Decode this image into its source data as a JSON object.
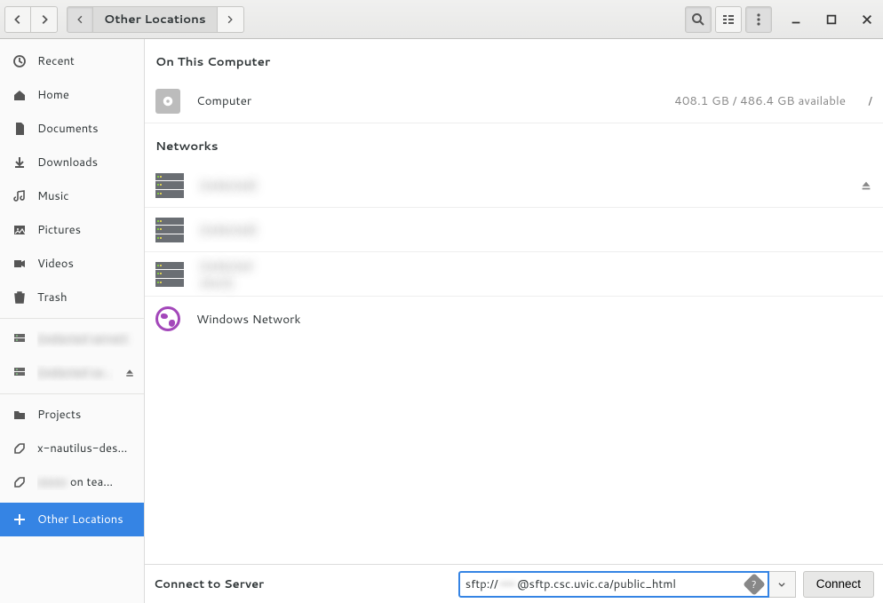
{
  "header": {
    "path_label": "Other Locations"
  },
  "sidebar": {
    "items": [
      {
        "icon": "recent",
        "label": "Recent"
      },
      {
        "icon": "home",
        "label": "Home"
      },
      {
        "icon": "folder",
        "label": "Documents"
      },
      {
        "icon": "download",
        "label": "Downloads"
      },
      {
        "icon": "music",
        "label": "Music"
      },
      {
        "icon": "picture",
        "label": "Pictures"
      },
      {
        "icon": "video",
        "label": "Videos"
      },
      {
        "icon": "trash",
        "label": "Trash"
      }
    ],
    "mounts": [
      {
        "label": "(redacted server)",
        "eject": false,
        "blur": true
      },
      {
        "label": "(redacted server)",
        "eject": true,
        "blur": true
      }
    ],
    "bookmarks": [
      {
        "icon": "folder",
        "label": "Projects"
      },
      {
        "icon": "link",
        "label": "x-nautilus-des…"
      },
      {
        "icon": "link",
        "label": " on tea…",
        "blur_prefix": true
      }
    ],
    "other_locations_label": "Other Locations"
  },
  "main": {
    "section_computer": "On This Computer",
    "computer_row": {
      "label": "Computer",
      "storage": "408.1 GB / 486.4 GB available",
      "mount": "/"
    },
    "section_networks": "Networks",
    "network_rows": [
      {
        "label": "(redacted)",
        "blur": true,
        "eject": true
      },
      {
        "label": "(redacted)",
        "blur": true,
        "eject": false
      },
      {
        "label": "(redacted short)",
        "blur": true,
        "eject": false
      }
    ],
    "windows_network_label": "Windows Network"
  },
  "footer": {
    "label": "Connect to Server",
    "addr_prefix": "sftp://",
    "addr_user_blur": "——",
    "addr_suffix": "@sftp.csc.uvic.ca/public_html",
    "connect_label": "Connect"
  }
}
